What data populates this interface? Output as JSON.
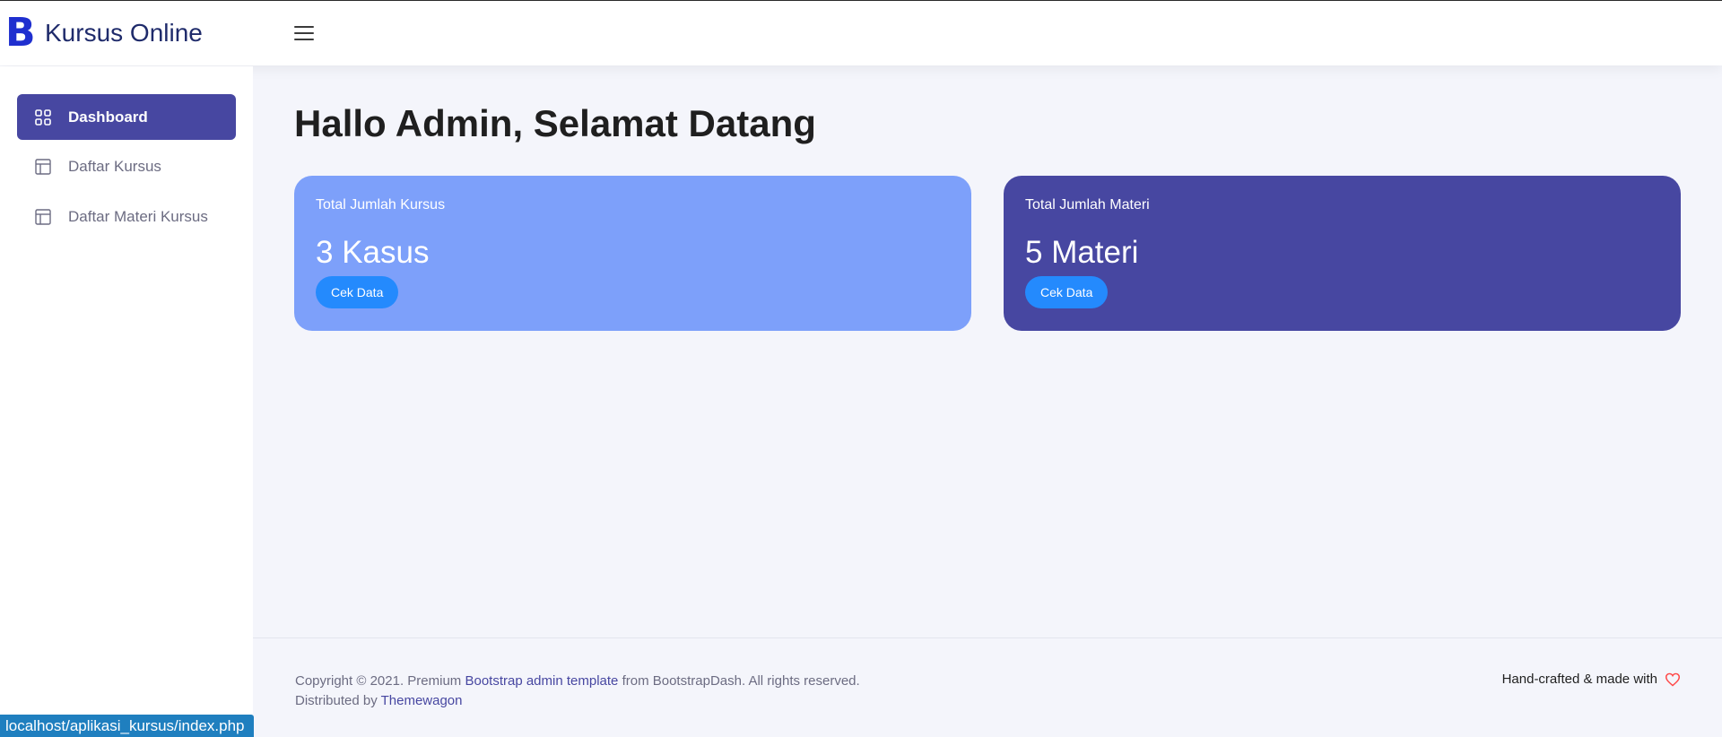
{
  "brand": {
    "logo_letter": "B",
    "title": "Kursus Online",
    "logo_color": "#1f2fcf"
  },
  "navbar": {
    "toggler_icon": "hamburger-menu-icon"
  },
  "sidebar": {
    "items": [
      {
        "label": "Dashboard",
        "icon": "grid-icon",
        "active": true
      },
      {
        "label": "Daftar Kursus",
        "icon": "layout-icon",
        "active": false
      },
      {
        "label": "Daftar Materi Kursus",
        "icon": "layout-icon",
        "active": false
      }
    ]
  },
  "main": {
    "title": "Hallo Admin, Selamat Datang",
    "cards": [
      {
        "label": "Total Jumlah Kursus",
        "value": "3 Kasus",
        "button": "Cek Data",
        "color": "#7da0fa"
      },
      {
        "label": "Total Jumlah Materi",
        "value": "5 Materi",
        "button": "Cek Data",
        "color": "#4747a1"
      }
    ]
  },
  "footer": {
    "copyright_prefix": "Copyright © 2021. Premium ",
    "copyright_link": "Bootstrap admin template",
    "copyright_suffix": " from BootstrapDash. All rights reserved.",
    "distributed_prefix": "Distributed by ",
    "distributed_link": "Themewagon",
    "right_text": "Hand-crafted & made with"
  },
  "statusbar": {
    "url": "localhost/aplikasi_kursus/index.php"
  },
  "colors": {
    "accent": "#4747a1",
    "button": "#248afd",
    "heart": "#ff4747"
  }
}
